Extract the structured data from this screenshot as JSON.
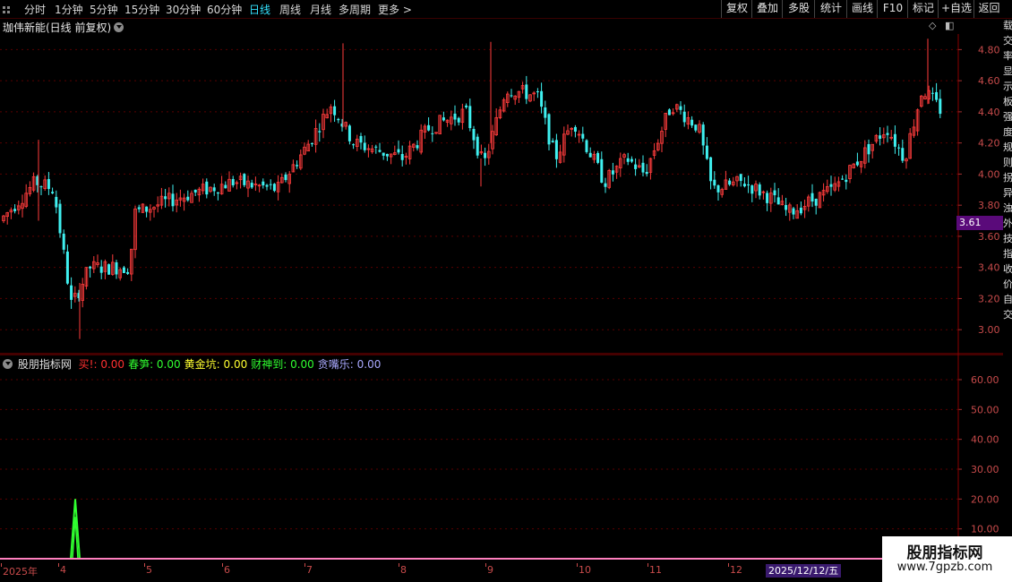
{
  "toolbar": {
    "periods": [
      "分时",
      "1分钟",
      "5分钟",
      "15分钟",
      "30分钟",
      "60分钟",
      "日线",
      "周线",
      "月线",
      "多周期",
      "更多 >"
    ],
    "active_period": "日线",
    "right_buttons": [
      "复权",
      "叠加",
      "多股",
      "统计",
      "画线",
      "F10",
      "标记",
      "+自选",
      "返回"
    ]
  },
  "chart_title": "珈伟新能(日线 前复权)",
  "main_panel": {
    "current_price_label": "3.61",
    "y_ticks": [
      "4.80",
      "4.60",
      "4.40",
      "4.20",
      "4.00",
      "3.80",
      "3.60",
      "3.40",
      "3.20",
      "3.00"
    ]
  },
  "indicator": {
    "name": "股朋指标网",
    "values": [
      {
        "label": "买!",
        "value": ": 0.00",
        "color": "#ff3030"
      },
      {
        "label": "春笋:",
        "value": " 0.00",
        "color": "#30ff30"
      },
      {
        "label": "黄金坑:",
        "value": " 0.00",
        "color": "#ffff30"
      },
      {
        "label": "财神到:",
        "value": " 0.00",
        "color": "#30ff30"
      },
      {
        "label": "贪嘴乐:",
        "value": " 0.00",
        "color": "#a9a9ff"
      }
    ],
    "y_ticks": [
      "60.00",
      "50.00",
      "40.00",
      "30.00",
      "20.00",
      "10.00"
    ]
  },
  "x_axis": {
    "labels": [
      "2025年",
      "4",
      "5",
      "6",
      "7",
      "8",
      "9",
      "10",
      "11",
      "12"
    ],
    "highlight_date": "2025/12/12/五"
  },
  "watermark": {
    "title": "股朋指标网",
    "url": "www.7gpzb.com"
  },
  "side_text": "载交率显示板强度规则拐异浊外技指收价自交"
}
